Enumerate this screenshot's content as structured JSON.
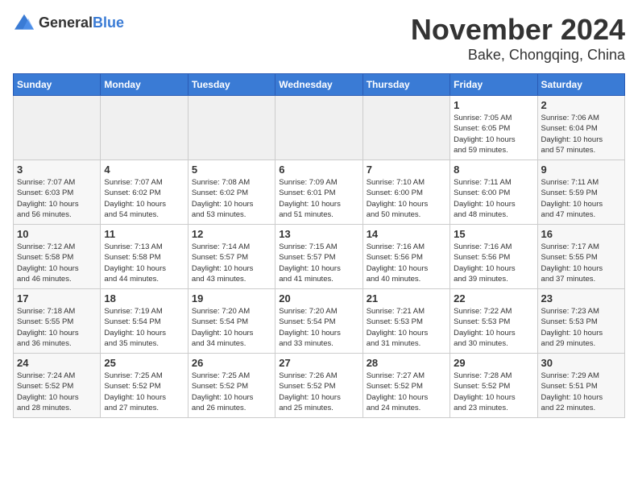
{
  "header": {
    "logo_general": "General",
    "logo_blue": "Blue",
    "title": "November 2024",
    "location": "Bake, Chongqing, China"
  },
  "calendar": {
    "days_of_week": [
      "Sunday",
      "Monday",
      "Tuesday",
      "Wednesday",
      "Thursday",
      "Friday",
      "Saturday"
    ],
    "weeks": [
      [
        {
          "day": "",
          "info": "",
          "empty": true
        },
        {
          "day": "",
          "info": "",
          "empty": true
        },
        {
          "day": "",
          "info": "",
          "empty": true
        },
        {
          "day": "",
          "info": "",
          "empty": true
        },
        {
          "day": "",
          "info": "",
          "empty": true
        },
        {
          "day": "1",
          "info": "Sunrise: 7:05 AM\nSunset: 6:05 PM\nDaylight: 10 hours\nand 59 minutes."
        },
        {
          "day": "2",
          "info": "Sunrise: 7:06 AM\nSunset: 6:04 PM\nDaylight: 10 hours\nand 57 minutes."
        }
      ],
      [
        {
          "day": "3",
          "info": "Sunrise: 7:07 AM\nSunset: 6:03 PM\nDaylight: 10 hours\nand 56 minutes."
        },
        {
          "day": "4",
          "info": "Sunrise: 7:07 AM\nSunset: 6:02 PM\nDaylight: 10 hours\nand 54 minutes."
        },
        {
          "day": "5",
          "info": "Sunrise: 7:08 AM\nSunset: 6:02 PM\nDaylight: 10 hours\nand 53 minutes."
        },
        {
          "day": "6",
          "info": "Sunrise: 7:09 AM\nSunset: 6:01 PM\nDaylight: 10 hours\nand 51 minutes."
        },
        {
          "day": "7",
          "info": "Sunrise: 7:10 AM\nSunset: 6:00 PM\nDaylight: 10 hours\nand 50 minutes."
        },
        {
          "day": "8",
          "info": "Sunrise: 7:11 AM\nSunset: 6:00 PM\nDaylight: 10 hours\nand 48 minutes."
        },
        {
          "day": "9",
          "info": "Sunrise: 7:11 AM\nSunset: 5:59 PM\nDaylight: 10 hours\nand 47 minutes."
        }
      ],
      [
        {
          "day": "10",
          "info": "Sunrise: 7:12 AM\nSunset: 5:58 PM\nDaylight: 10 hours\nand 46 minutes."
        },
        {
          "day": "11",
          "info": "Sunrise: 7:13 AM\nSunset: 5:58 PM\nDaylight: 10 hours\nand 44 minutes."
        },
        {
          "day": "12",
          "info": "Sunrise: 7:14 AM\nSunset: 5:57 PM\nDaylight: 10 hours\nand 43 minutes."
        },
        {
          "day": "13",
          "info": "Sunrise: 7:15 AM\nSunset: 5:57 PM\nDaylight: 10 hours\nand 41 minutes."
        },
        {
          "day": "14",
          "info": "Sunrise: 7:16 AM\nSunset: 5:56 PM\nDaylight: 10 hours\nand 40 minutes."
        },
        {
          "day": "15",
          "info": "Sunrise: 7:16 AM\nSunset: 5:56 PM\nDaylight: 10 hours\nand 39 minutes."
        },
        {
          "day": "16",
          "info": "Sunrise: 7:17 AM\nSunset: 5:55 PM\nDaylight: 10 hours\nand 37 minutes."
        }
      ],
      [
        {
          "day": "17",
          "info": "Sunrise: 7:18 AM\nSunset: 5:55 PM\nDaylight: 10 hours\nand 36 minutes."
        },
        {
          "day": "18",
          "info": "Sunrise: 7:19 AM\nSunset: 5:54 PM\nDaylight: 10 hours\nand 35 minutes."
        },
        {
          "day": "19",
          "info": "Sunrise: 7:20 AM\nSunset: 5:54 PM\nDaylight: 10 hours\nand 34 minutes."
        },
        {
          "day": "20",
          "info": "Sunrise: 7:20 AM\nSunset: 5:54 PM\nDaylight: 10 hours\nand 33 minutes."
        },
        {
          "day": "21",
          "info": "Sunrise: 7:21 AM\nSunset: 5:53 PM\nDaylight: 10 hours\nand 31 minutes."
        },
        {
          "day": "22",
          "info": "Sunrise: 7:22 AM\nSunset: 5:53 PM\nDaylight: 10 hours\nand 30 minutes."
        },
        {
          "day": "23",
          "info": "Sunrise: 7:23 AM\nSunset: 5:53 PM\nDaylight: 10 hours\nand 29 minutes."
        }
      ],
      [
        {
          "day": "24",
          "info": "Sunrise: 7:24 AM\nSunset: 5:52 PM\nDaylight: 10 hours\nand 28 minutes."
        },
        {
          "day": "25",
          "info": "Sunrise: 7:25 AM\nSunset: 5:52 PM\nDaylight: 10 hours\nand 27 minutes."
        },
        {
          "day": "26",
          "info": "Sunrise: 7:25 AM\nSunset: 5:52 PM\nDaylight: 10 hours\nand 26 minutes."
        },
        {
          "day": "27",
          "info": "Sunrise: 7:26 AM\nSunset: 5:52 PM\nDaylight: 10 hours\nand 25 minutes."
        },
        {
          "day": "28",
          "info": "Sunrise: 7:27 AM\nSunset: 5:52 PM\nDaylight: 10 hours\nand 24 minutes."
        },
        {
          "day": "29",
          "info": "Sunrise: 7:28 AM\nSunset: 5:52 PM\nDaylight: 10 hours\nand 23 minutes."
        },
        {
          "day": "30",
          "info": "Sunrise: 7:29 AM\nSunset: 5:51 PM\nDaylight: 10 hours\nand 22 minutes."
        }
      ]
    ]
  }
}
